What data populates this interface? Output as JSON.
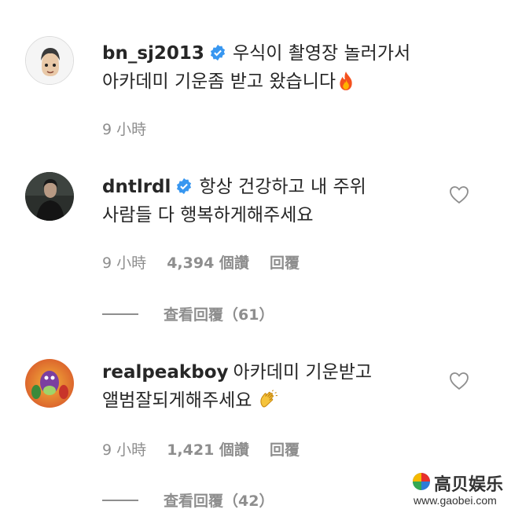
{
  "caption": {
    "username": "bn_sj2013",
    "text_line1": "우식이 촬영장 놀러가서",
    "text_line2": "아카데미 기운좀 받고 왔습니다",
    "emoji": "fire-icon",
    "time": "9 小時"
  },
  "comments": [
    {
      "username": "dntlrdl",
      "verified": true,
      "text_line1": "항상 건강하고 내 주위",
      "text_line2": "사람들 다 행복하게해주세요",
      "time": "9 小時",
      "likes": "4,394 個讚",
      "reply_label": "回覆",
      "view_replies": "查看回覆（61）"
    },
    {
      "username": "realpeakboy",
      "verified": false,
      "text_line1": "아카데미 기운받고",
      "text_line2": "앨범잘되게해주세요",
      "emoji": "clapping-hands-icon",
      "time": "9 小時",
      "likes": "1,421 個讚",
      "reply_label": "回覆",
      "view_replies": "查看回覆（42）"
    }
  ],
  "watermark": {
    "brand": "高贝娱乐",
    "url": "www.gaobei.com"
  },
  "colors": {
    "text": "#262626",
    "meta": "#8e8e8e",
    "verified": "#3897f0"
  }
}
